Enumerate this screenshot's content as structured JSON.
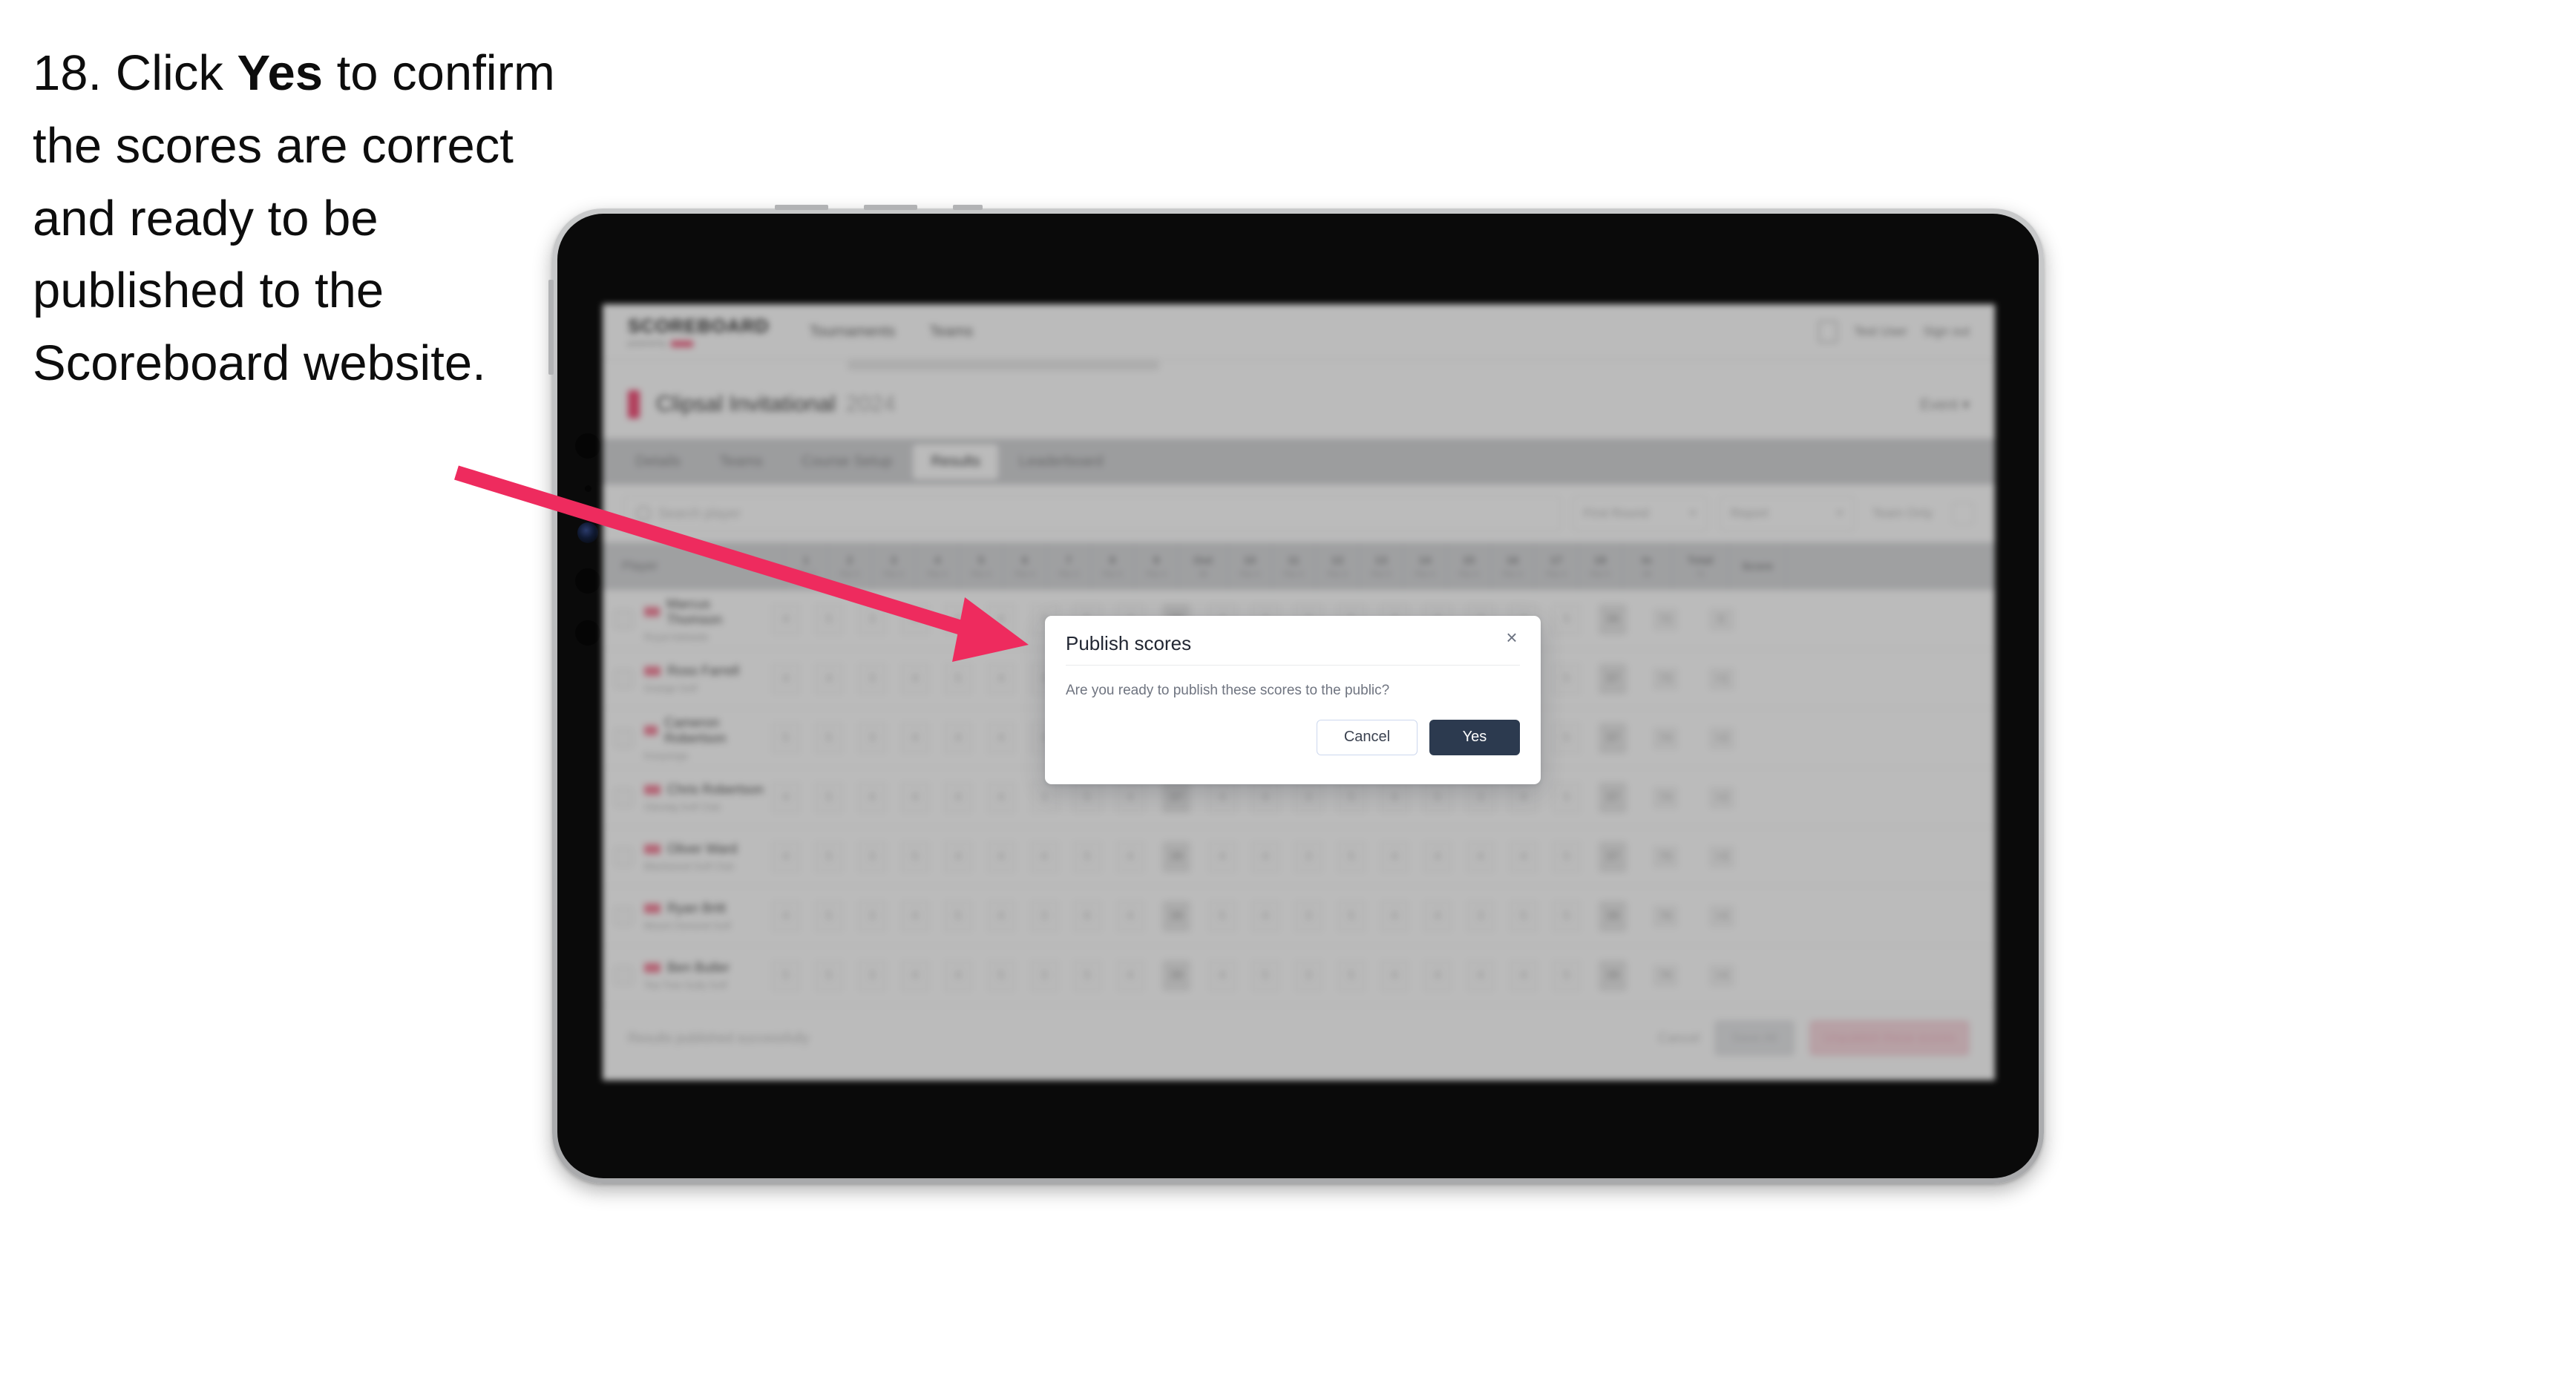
{
  "instruction": {
    "step_number": "18.",
    "text_before": " Click ",
    "emphasis": "Yes",
    "text_after": " to confirm the scores are correct and ready to be published to the Scoreboard website."
  },
  "colors": {
    "arrow": "#ee2b5e",
    "primary_button": "#2c3a4f",
    "brand_accent": "#f2547c",
    "device_bezel": "#b8b9bb",
    "screen_black": "#0a0a0a"
  },
  "dialog": {
    "title": "Publish scores",
    "message": "Are you ready to publish these scores to the public?",
    "close_icon": "×",
    "cancel_label": "Cancel",
    "confirm_label": "Yes"
  },
  "app": {
    "brand": {
      "word": "SCOREBOARD",
      "sub": "powered by"
    },
    "nav": [
      {
        "label": "Tournaments"
      },
      {
        "label": "Teams"
      }
    ],
    "header_right": {
      "icon": "user-avatar-icon",
      "user": "Test User",
      "signout": "Sign out"
    },
    "title_bar": {
      "title": "Clipsal Invitational",
      "muted": "2024",
      "right_action": "Event ▾"
    },
    "tabs": [
      {
        "label": "Details",
        "active": false
      },
      {
        "label": "Teams",
        "active": false
      },
      {
        "label": "Course Setup",
        "active": false
      },
      {
        "label": "Results",
        "active": true
      },
      {
        "label": "Leaderboard",
        "active": false
      }
    ],
    "filters": {
      "search_placeholder": "Search player",
      "select_round": "First Round",
      "select_report": "Report",
      "toggle_label": "Team Only",
      "toggle_icon": "checkbox-icon"
    },
    "table": {
      "player_header": "Player",
      "holes": [
        {
          "n": "1",
          "p": "Par 4"
        },
        {
          "n": "2",
          "p": "Par 5"
        },
        {
          "n": "3",
          "p": "Par 3"
        },
        {
          "n": "4",
          "p": "Par 4"
        },
        {
          "n": "5",
          "p": "Par 4"
        },
        {
          "n": "6",
          "p": "Par 4"
        },
        {
          "n": "7",
          "p": "Par 3"
        },
        {
          "n": "8",
          "p": "Par 5"
        },
        {
          "n": "9",
          "p": "Par 4"
        }
      ],
      "out_header": {
        "n": "Out",
        "p": "36"
      },
      "holes_back": [
        {
          "n": "10",
          "p": "Par 4"
        },
        {
          "n": "11",
          "p": "Par 4"
        },
        {
          "n": "12",
          "p": "Par 3"
        },
        {
          "n": "13",
          "p": "Par 5"
        },
        {
          "n": "14",
          "p": "Par 4"
        },
        {
          "n": "15",
          "p": "Par 4"
        },
        {
          "n": "16",
          "p": "Par 3"
        },
        {
          "n": "17",
          "p": "Par 4"
        },
        {
          "n": "18",
          "p": "Par 5"
        }
      ],
      "in_header": {
        "n": "In",
        "p": "36"
      },
      "total_header": {
        "n": "Total",
        "p": "72"
      },
      "score_header": {
        "n": "Score",
        "p": ""
      },
      "rows": [
        {
          "name": "Marcus Thomson",
          "club": "Royal Adelaide",
          "front": [
            "4",
            "5",
            "3",
            "4",
            "4",
            "4",
            "3",
            "5",
            "4"
          ],
          "out": "36",
          "back": [
            "4",
            "4",
            "3",
            "5",
            "4",
            "4",
            "3",
            "4",
            "5"
          ],
          "in": "36",
          "total": "72",
          "score": "E",
          "pill_a": "72",
          "pill_b": "E"
        },
        {
          "name": "Ross Farrell",
          "club": "Grange Golf",
          "front": [
            "4",
            "4",
            "3",
            "4",
            "5",
            "4",
            "3",
            "5",
            "4"
          ],
          "out": "36",
          "back": [
            "4",
            "5",
            "3",
            "5",
            "4",
            "4",
            "3",
            "4",
            "5"
          ],
          "in": "37",
          "total": "73",
          "score": "+1",
          "pill_a": "73",
          "pill_b": "+1"
        },
        {
          "name": "Cameron Robertson",
          "club": "Kooyonga",
          "front": [
            "5",
            "5",
            "3",
            "4",
            "4",
            "4",
            "3",
            "5",
            "4"
          ],
          "out": "37",
          "back": [
            "4",
            "4",
            "3",
            "5",
            "5",
            "4",
            "3",
            "4",
            "5"
          ],
          "in": "37",
          "total": "74",
          "score": "+2",
          "pill_a": "74",
          "pill_b": "+2"
        },
        {
          "name": "Chris Robertson",
          "club": "Glenelg Golf Club",
          "front": [
            "4",
            "5",
            "4",
            "4",
            "4",
            "4",
            "3",
            "5",
            "4"
          ],
          "out": "37",
          "back": [
            "4",
            "4",
            "3",
            "5",
            "4",
            "5",
            "3",
            "4",
            "5"
          ],
          "in": "37",
          "total": "74",
          "score": "+2",
          "pill_a": "74",
          "pill_b": "+2"
        },
        {
          "name": "Oliver Ward",
          "club": "Blackwood Golf Club",
          "front": [
            "4",
            "5",
            "3",
            "5",
            "4",
            "4",
            "4",
            "5",
            "4"
          ],
          "out": "38",
          "back": [
            "4",
            "4",
            "3",
            "5",
            "4",
            "4",
            "4",
            "4",
            "5"
          ],
          "in": "37",
          "total": "75",
          "score": "+3",
          "pill_a": "75",
          "pill_b": "+3"
        },
        {
          "name": "Ryan Britt",
          "club": "Mount Osmond Golf",
          "front": [
            "4",
            "5",
            "3",
            "4",
            "5",
            "4",
            "3",
            "6",
            "4"
          ],
          "out": "38",
          "back": [
            "5",
            "4",
            "3",
            "5",
            "4",
            "4",
            "3",
            "5",
            "5"
          ],
          "in": "38",
          "total": "76",
          "score": "+4",
          "pill_a": "76",
          "pill_b": "+4"
        },
        {
          "name": "Ben Butler",
          "club": "Tea Tree Gully Golf",
          "front": [
            "5",
            "5",
            "3",
            "4",
            "4",
            "5",
            "3",
            "5",
            "4"
          ],
          "out": "38",
          "back": [
            "4",
            "5",
            "3",
            "5",
            "4",
            "4",
            "4",
            "4",
            "5"
          ],
          "in": "38",
          "total": "76",
          "score": "+4",
          "pill_a": "76",
          "pill_b": "+4"
        }
      ]
    },
    "footer": {
      "note": "Results published successfully",
      "link": "Cancel",
      "grey_button": "Save All",
      "pink_button": "Unpublish these scores"
    }
  }
}
